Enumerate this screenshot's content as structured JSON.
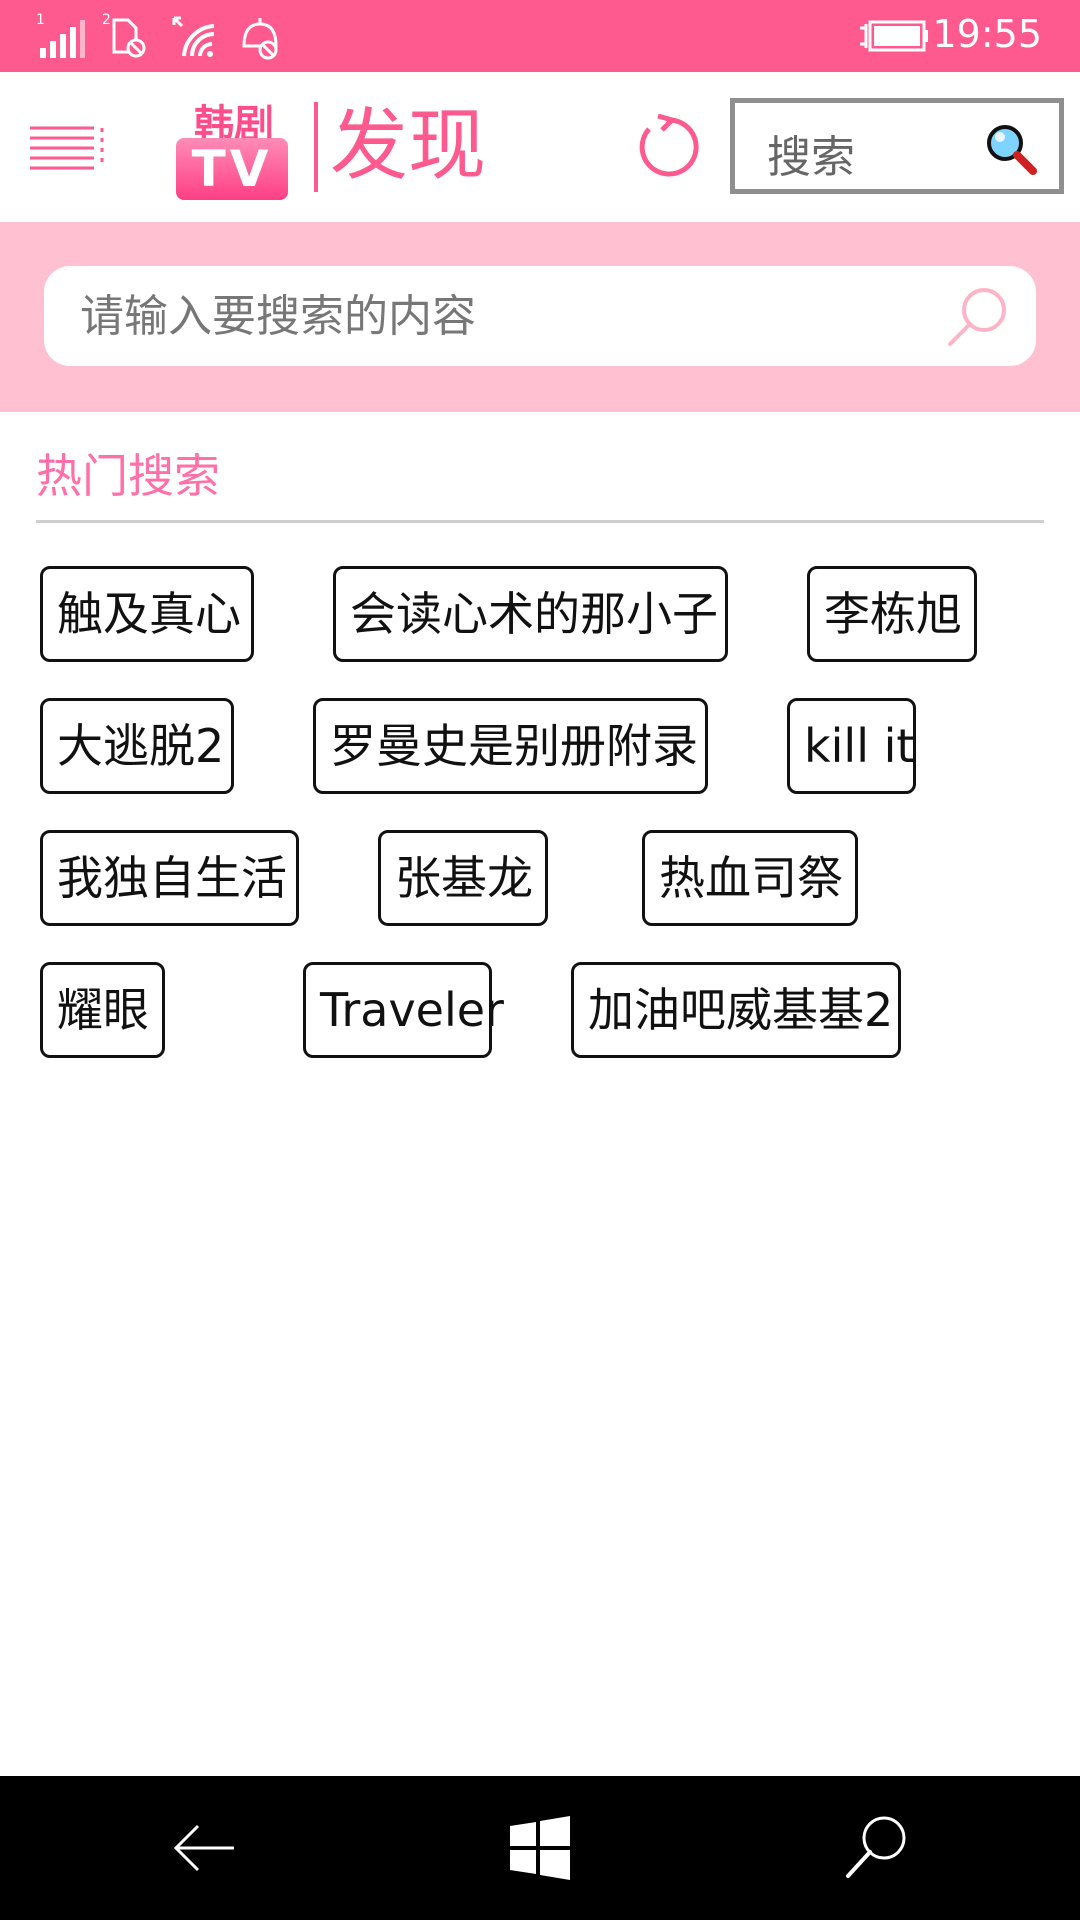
{
  "status_bar": {
    "time": "19:55",
    "icons": [
      "signal-sim1-icon",
      "sim2-no-data-icon",
      "wifi-icon",
      "quiet-hours-icon",
      "battery-charging-icon"
    ]
  },
  "header": {
    "menu_icon": "hamburger-menu-icon",
    "logo": {
      "top_text": "韩剧",
      "badge_text": "TV"
    },
    "title": "发现",
    "refresh_icon": "refresh-icon",
    "search_label": "搜索",
    "search_icon": "magnifier-icon"
  },
  "search": {
    "placeholder": "请输入要搜索的内容",
    "icon": "search-icon"
  },
  "hot_search": {
    "title": "热门搜索",
    "tags": [
      "触及真心",
      "会读心术的那小子",
      "李栋旭",
      "大逃脱2",
      "罗曼史是别册附录",
      "kill it",
      "我独自生活",
      "张基龙",
      "热血司祭",
      "耀眼",
      "Traveler",
      "加油吧威基基2"
    ]
  },
  "nav_bar": {
    "back_icon": "back-arrow-icon",
    "home_icon": "windows-logo-icon",
    "search_icon": "search-icon"
  },
  "colors": {
    "accent": "#ff5a8f",
    "band": "#ffc0d1",
    "hot_title": "#ff6fa8"
  }
}
